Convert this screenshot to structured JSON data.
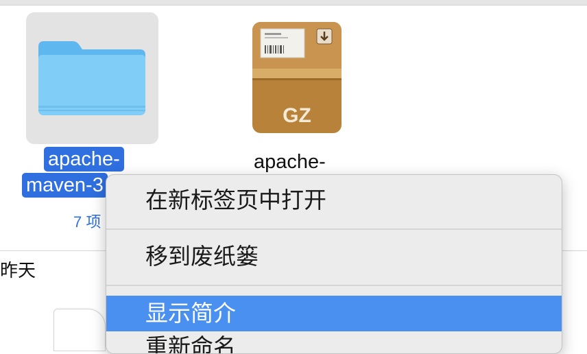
{
  "files": {
    "folder": {
      "name_line1": "apache-",
      "name_line2": "maven-3",
      "item_count": "7 项",
      "icon": "folder-icon",
      "selected": true
    },
    "archive": {
      "name_line1": "apache-",
      "badge": "GZ",
      "icon": "gz-archive-icon"
    }
  },
  "section": {
    "date_header": "昨天"
  },
  "context_menu": {
    "items": [
      {
        "label": "在新标签页中打开"
      },
      {
        "label": "移到废纸篓"
      },
      {
        "label": "显示简介",
        "highlighted": true
      },
      {
        "label": "重新命名"
      }
    ]
  },
  "colors": {
    "selection": "#2f6fe0",
    "menu_highlight": "#4a90f0",
    "folder_blue": "#6cc2f4",
    "archive_brown": "#b8823a"
  }
}
